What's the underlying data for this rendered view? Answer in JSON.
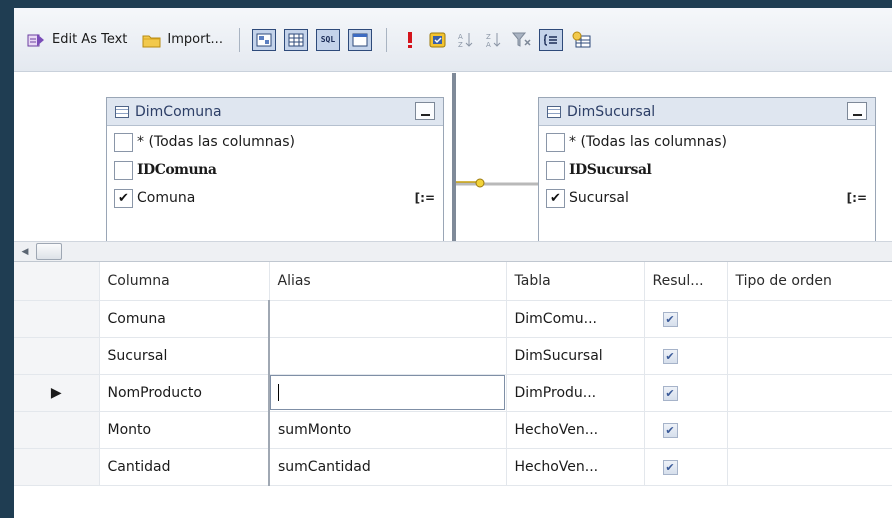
{
  "toolbar": {
    "edit_as_text": "Edit As Text",
    "import": "Import...",
    "sql_button": "SQL"
  },
  "tables": [
    {
      "title": "DimComuna",
      "columns": [
        {
          "label": "* (Todas las columnas)",
          "checked": false,
          "bold": false
        },
        {
          "label": "IDComuna",
          "checked": false,
          "bold": true
        },
        {
          "label": "Comuna",
          "checked": true,
          "bold": false
        }
      ]
    },
    {
      "title": "DimSucursal",
      "columns": [
        {
          "label": "* (Todas las columnas)",
          "checked": false,
          "bold": false
        },
        {
          "label": "IDSucursal",
          "checked": false,
          "bold": true
        },
        {
          "label": "Sucursal",
          "checked": true,
          "bold": false
        }
      ]
    }
  ],
  "grid": {
    "headers": [
      "Columna",
      "Alias",
      "Tabla",
      "Resul...",
      "Tipo de orden"
    ],
    "rows": [
      {
        "columna": "Comuna",
        "alias": "",
        "tabla": "DimComu...",
        "output": true
      },
      {
        "columna": "Sucursal",
        "alias": "",
        "tabla": "DimSucursal",
        "output": true
      },
      {
        "columna": "NomProducto",
        "alias": "",
        "tabla": "DimProdu...",
        "output": true
      },
      {
        "columna": "Monto",
        "alias": "sumMonto",
        "tabla": "HechoVen...",
        "output": true
      },
      {
        "columna": "Cantidad",
        "alias": "sumCantidad",
        "tabla": "HechoVen...",
        "output": true
      }
    ]
  },
  "colors": {
    "accent": "#2e4a7a",
    "background": "#1f3d52"
  }
}
